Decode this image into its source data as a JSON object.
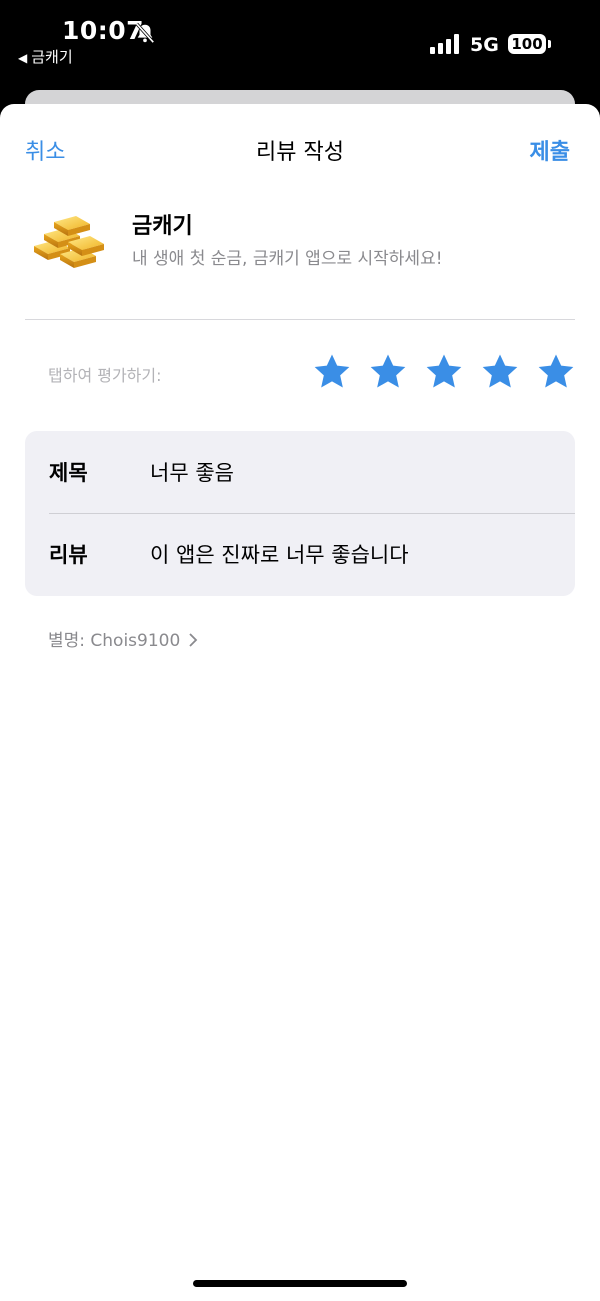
{
  "status_bar": {
    "time": "10:07",
    "back_app": "금캐기",
    "network": "5G",
    "battery": "100"
  },
  "nav": {
    "cancel_label": "취소",
    "title": "리뷰 작성",
    "submit_label": "제출"
  },
  "app": {
    "name": "금캐기",
    "subtitle": "내 생애 첫 순금, 금캐기 앱으로 시작하세요!",
    "icon": "gold-bars-icon"
  },
  "rating": {
    "label": "탭하여 평가하기:",
    "stars": 5,
    "max_stars": 5,
    "star_color": "#3a8ee6"
  },
  "form": {
    "title_label": "제목",
    "title_value": "너무 좋음",
    "review_label": "리뷰",
    "review_value": "이 앱은 진짜로 너무 좋습니다"
  },
  "nickname": {
    "text": "별명: Chois9100"
  },
  "colors": {
    "accent": "#3a8ee6",
    "secondary_text": "#8a8a8e",
    "card_bg": "#f0f0f5"
  }
}
